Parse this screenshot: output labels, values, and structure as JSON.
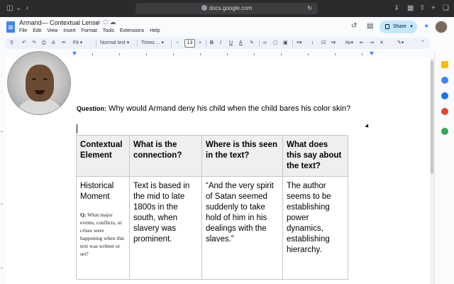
{
  "browser": {
    "url": "docs.google.com"
  },
  "doc": {
    "title": "Armand— Contextual Lense",
    "menu": [
      "File",
      "Edit",
      "View",
      "Insert",
      "Format",
      "Tools",
      "Extensions",
      "Help"
    ],
    "share_label": "Share"
  },
  "toolbar": {
    "zoom": "Fit",
    "style": "Normal text",
    "font": "Times ...",
    "font_size": "13"
  },
  "content": {
    "question_label": "Question:",
    "question_text": " Why would Armand deny his child when the child bares his color skin?",
    "table": {
      "headers": [
        "Contextual Element",
        "What is the connection?",
        "Where is this seen in the text?",
        "What does this say about the text?"
      ],
      "row1": {
        "element": "Historical Moment",
        "sub_q_label": "Q:",
        "sub_q_text": " What major events, conflicts, or crises were happening when this text was written or set?",
        "connection": "Text is based in the mid to late 1800s in the south, when slavery was prominent.",
        "where": "“And the very spirit of Satan seemed suddenly to take hold of him in his dealings with the slaves.”",
        "meaning": "The author seems to be establishing power dynamics, establishing hierarchy."
      }
    }
  },
  "icons": {
    "back": "chevron-left-icon",
    "sidebar": "sidebar-icon",
    "history": "history-icon",
    "comments": "comment-icon",
    "gemini": "gemini-icon"
  },
  "colors": {
    "share_bg": "#c2e7ff",
    "doc_blue": "#4285f4",
    "header_cell": "#efefef"
  }
}
